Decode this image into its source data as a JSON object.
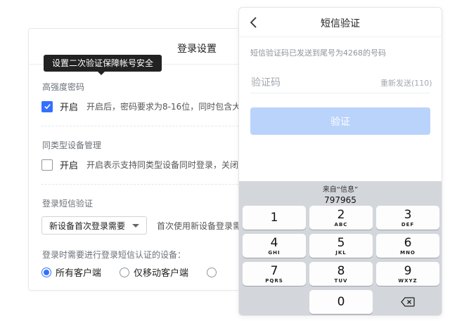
{
  "settings": {
    "title": "登录设置",
    "password": {
      "section_label": "高强度密码",
      "option_label": "开启",
      "checked": true,
      "description": "开启后，密码要求为8-16位，同时包含大"
    },
    "device": {
      "section_label": "同类型设备管理",
      "option_label": "开启",
      "checked": false,
      "description": "开启表示支持同类型设备同时登录，关闭"
    },
    "sms": {
      "section_label": "登录短信验证",
      "select_value": "新设备首次登录需要",
      "select_hint": "首次使用新设备登录需",
      "devices_label": "登录时需要进行登录短信认证的设备：",
      "radio_options": [
        "所有客户端",
        "仅移动客户端"
      ],
      "selected_index": 0
    }
  },
  "tooltip": {
    "text": "设置二次验证保障帐号安全"
  },
  "phone": {
    "nav": {
      "title": "短信验证",
      "back_icon": "chevron-left-icon"
    },
    "hint": "短信验证码已发送到尾号为4268的号码",
    "code_input": {
      "placeholder": "验证码",
      "value": ""
    },
    "resend_label": "重新发送(110)",
    "verify_label": "验证",
    "keyboard": {
      "suggestion_source": "来自“信息”",
      "suggestion_code": "797965",
      "keys": [
        {
          "num": "1",
          "letters": ""
        },
        {
          "num": "2",
          "letters": "ABC"
        },
        {
          "num": "3",
          "letters": "DEF"
        },
        {
          "num": "4",
          "letters": "GHI"
        },
        {
          "num": "5",
          "letters": "JKL"
        },
        {
          "num": "6",
          "letters": "MNO"
        },
        {
          "num": "7",
          "letters": "PQRS"
        },
        {
          "num": "8",
          "letters": "TUV"
        },
        {
          "num": "9",
          "letters": "WXYZ"
        }
      ],
      "zero_key": "0",
      "delete_icon": "backspace-icon"
    }
  },
  "colors": {
    "accent": "#3370ff",
    "button_disabled": "#b9d3fb",
    "keyboard_bg": "#d3d6db",
    "tooltip_bg": "#222222"
  }
}
